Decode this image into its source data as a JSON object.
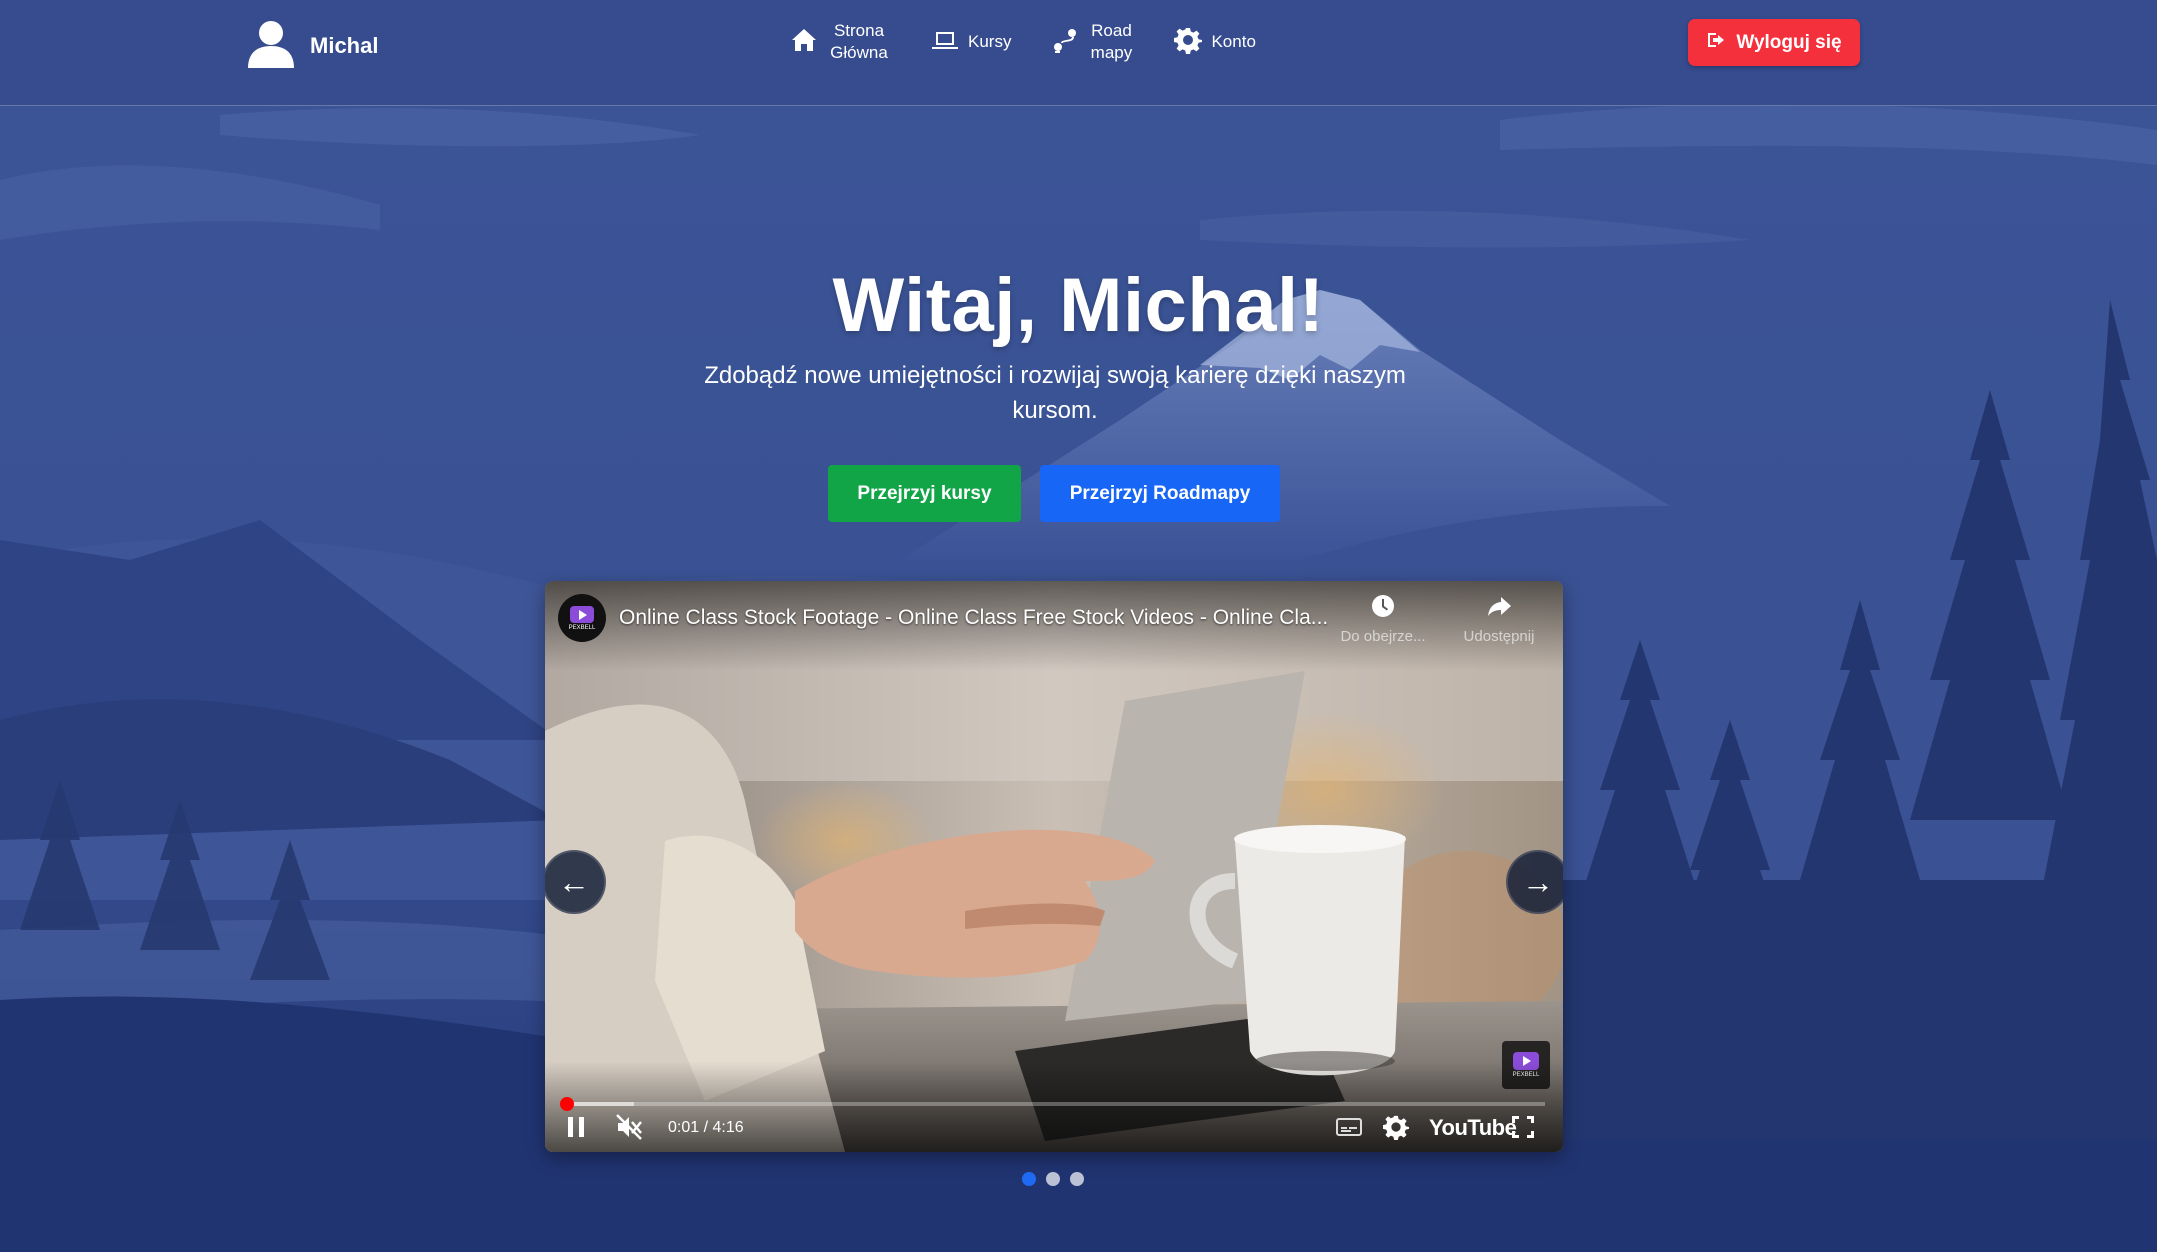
{
  "app": {
    "user_name": "Michal"
  },
  "nav": {
    "items": [
      {
        "label": "Strona Główna",
        "icon": "home-icon"
      },
      {
        "label": "Kursy",
        "icon": "laptop-icon"
      },
      {
        "label": "Road mapy",
        "icon": "route-icon"
      },
      {
        "label": "Konto",
        "icon": "gear-icon"
      }
    ],
    "logout_label": "Wyloguj się"
  },
  "hero": {
    "title": "Witaj, Michal!",
    "subtitle": "Zdobądź nowe umiejętności i rozwijaj swoją karierę dzięki naszym kursom.",
    "btn_courses": "Przejrzyj kursy",
    "btn_roadmaps": "Przejrzyj Roadmapy"
  },
  "video": {
    "title": "Online Class Stock Footage - Online Class Free Stock Videos - Online Cla...",
    "channel_badge": "PEXBELL",
    "watch_later_label": "Do obejrze...",
    "share_label": "Udostępnij",
    "time_display": "0:01 / 4:16",
    "progress_played": 0.004,
    "progress_buffered": 0.072,
    "youtube_label": "YouTube",
    "prev_arrow": "←",
    "next_arrow": "→"
  },
  "carousel": {
    "slide_count": 3,
    "active_index": 0
  },
  "colors": {
    "nav_bg": "#364c8e",
    "logout": "#f4303d",
    "btn_courses": "#12a547",
    "btn_roadmaps": "#1766f5",
    "dot_active": "#1f6af2",
    "progress": "#ff0000"
  }
}
